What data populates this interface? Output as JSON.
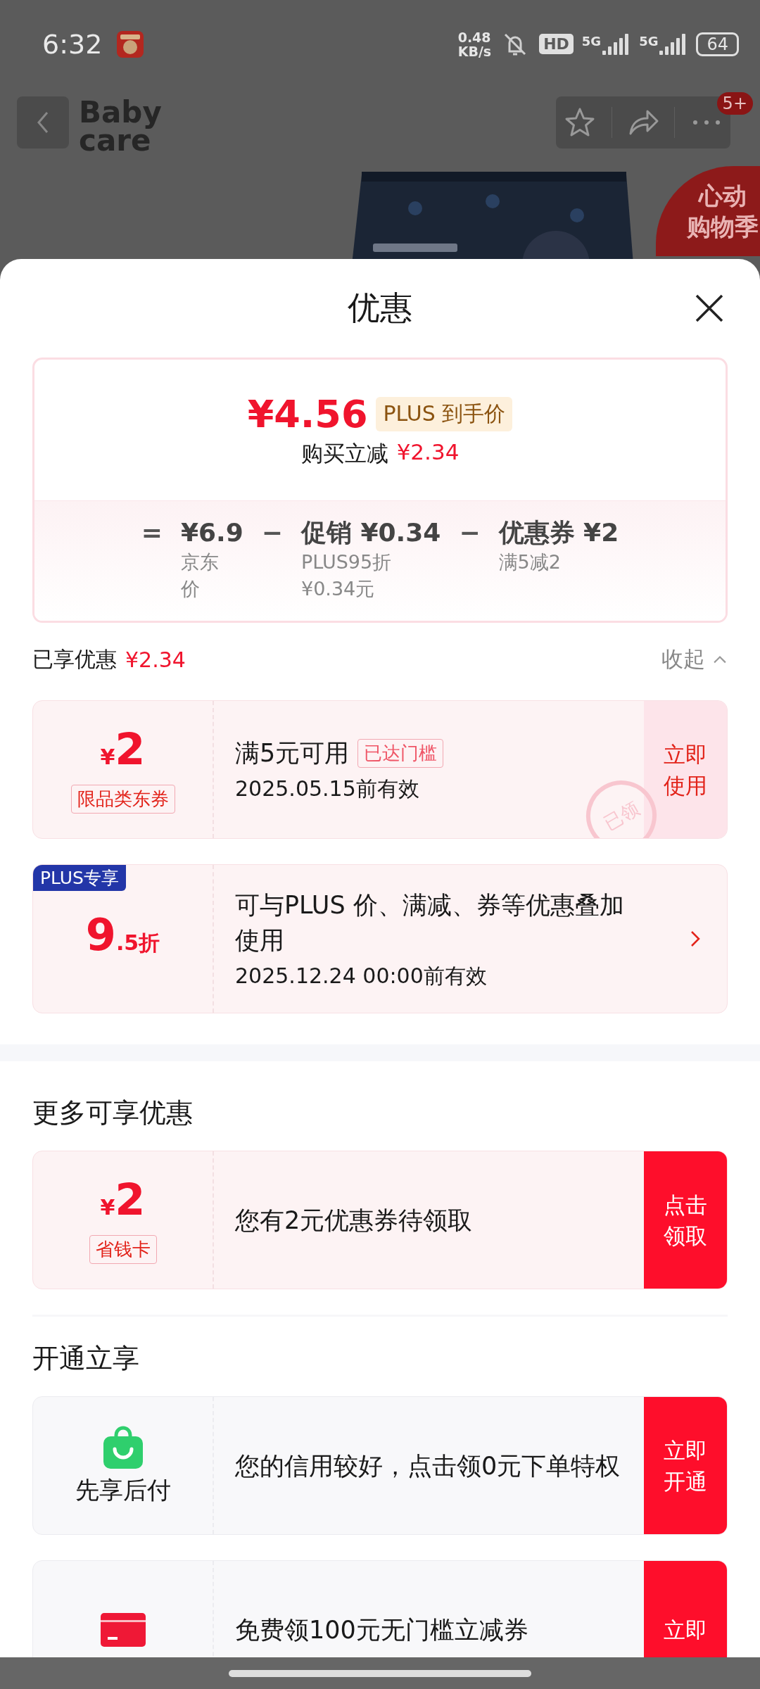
{
  "status_bar": {
    "time": "6:32",
    "net_speed": "0.48",
    "net_unit": "KB/s",
    "hd": "HD",
    "networks": [
      "5G",
      "5G"
    ],
    "battery": "64"
  },
  "product_page": {
    "logo": [
      "Baby",
      "care"
    ],
    "badge": "5+",
    "banner": [
      "心动",
      "购物季"
    ]
  },
  "sheet": {
    "title": "优惠",
    "price_card": {
      "price": "¥4.56",
      "price_label": "PLUS 到手价",
      "saving_label": "购买立减",
      "saving": "¥2.34",
      "breakdown": [
        {
          "op": "=",
          "amount": "¥6.9",
          "notes": [
            "京东价"
          ]
        },
        {
          "op": "−",
          "amount": "促销 ¥0.34",
          "notes": [
            "PLUS95折",
            "¥0.34元"
          ]
        },
        {
          "op": "−",
          "amount": "优惠券 ¥2",
          "notes": [
            "满5减2"
          ]
        }
      ]
    },
    "enjoyed": {
      "label": "已享优惠",
      "amount": "¥2.34",
      "toggle": "收起",
      "expanded": true
    },
    "coupons": [
      {
        "kind": "coupon",
        "currency": "¥",
        "amount": "2",
        "tag": "限品类东券",
        "title": "满5元可用",
        "status": "已达门槛",
        "validity": "2025.05.15前有效",
        "action": "立即使用",
        "claimed": true,
        "stamp": "已领"
      },
      {
        "kind": "discount",
        "badge": "PLUS专享",
        "amount": "9",
        "suffix": ".5折",
        "description": "可与PLUS 价、满减、券等优惠叠加使用",
        "validity": "2025.12.24 00:00前有效"
      }
    ],
    "more": {
      "title": "更多可享优惠",
      "items": [
        {
          "kind": "coupon",
          "currency": "¥",
          "amount": "2",
          "tag": "省钱卡",
          "text": "您有2元优惠券待领取",
          "action": "点击领取",
          "claimed": false
        }
      ]
    },
    "open": {
      "title": "开通立享",
      "items": [
        {
          "kind": "pay_later",
          "label": "先享后付",
          "text": "您的信用较好，点击领0元下单特权",
          "action": "立即开通"
        },
        {
          "kind": "card_offer",
          "text": "免费领100元无门槛立减券",
          "action": "立即"
        }
      ]
    }
  }
}
